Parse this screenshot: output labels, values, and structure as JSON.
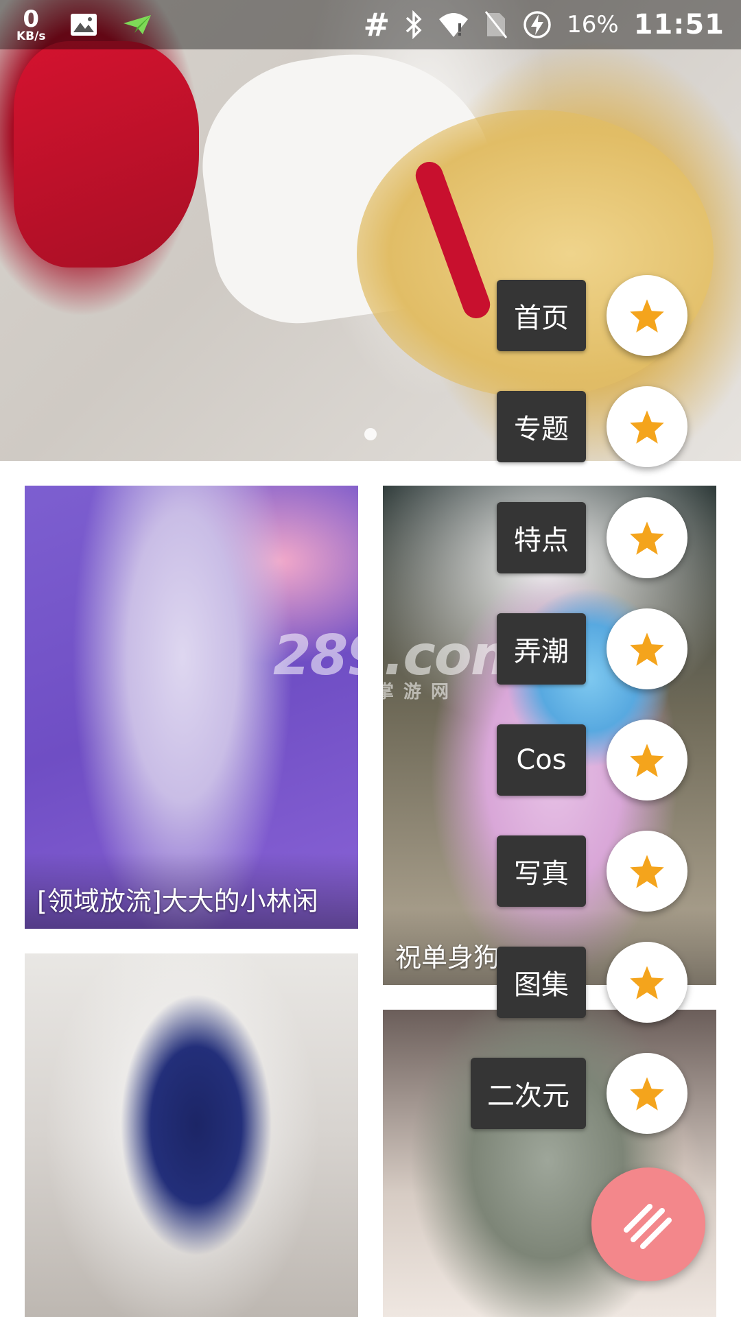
{
  "status_bar": {
    "net_speed_value": "0",
    "net_speed_unit": "KB/s",
    "hash_symbol": "#",
    "battery_percent": "16%",
    "time": "11:51",
    "icons": [
      "image-icon",
      "send-icon",
      "bluetooth-icon",
      "wifi-icon",
      "no-sim-icon",
      "battery-charging-icon"
    ]
  },
  "banner": {
    "pager_dots": 1
  },
  "cards": [
    {
      "caption": "[领域放流]大大的小林闲"
    },
    {
      "caption": "祝单身狗"
    },
    {
      "caption": ""
    },
    {
      "caption": ""
    }
  ],
  "watermark": {
    "text": "289.com",
    "sub": "掌游网"
  },
  "speed_dial": {
    "items": [
      {
        "label": "首页",
        "icon": "star-icon"
      },
      {
        "label": "专题",
        "icon": "star-icon"
      },
      {
        "label": "特点",
        "icon": "star-icon"
      },
      {
        "label": "弄潮",
        "icon": "star-icon"
      },
      {
        "label": "Cos",
        "icon": "star-icon"
      },
      {
        "label": "写真",
        "icon": "star-icon"
      },
      {
        "label": "图集",
        "icon": "star-icon"
      },
      {
        "label": "二次元",
        "icon": "star-icon"
      }
    ],
    "main_button_icon": "menu-lines-icon"
  },
  "colors": {
    "star": "#F4A41C",
    "fab_main": "#F3878B",
    "label_bg": "#353535"
  }
}
